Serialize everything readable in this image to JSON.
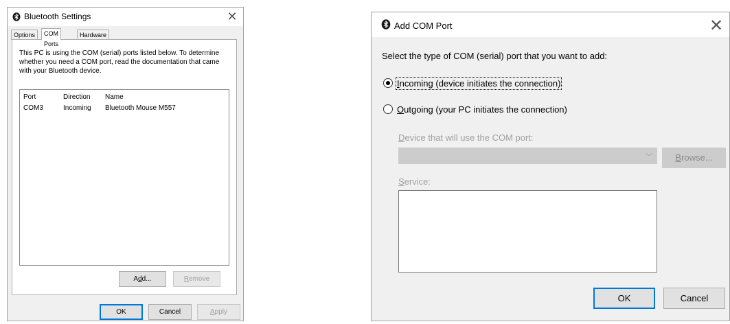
{
  "bluetooth_settings": {
    "title": "Bluetooth Settings",
    "tabs": [
      {
        "label": "Options",
        "active": false
      },
      {
        "label": "COM Ports",
        "active": true
      },
      {
        "label": "Hardware",
        "active": false
      }
    ],
    "intro": "This PC is using the COM (serial) ports listed below. To determine whether you need a COM port, read the documentation that came with your Bluetooth device.",
    "columns": [
      "Port",
      "Direction",
      "Name"
    ],
    "rows": [
      {
        "port": "COM3",
        "direction": "Incoming",
        "name": "Bluetooth Mouse M557"
      }
    ],
    "add_button": {
      "pre": "A",
      "key": "d",
      "post": "d..."
    },
    "remove_button": {
      "pre": "",
      "key": "R",
      "post": "emove"
    },
    "ok_button": "OK",
    "cancel_button": "Cancel",
    "apply_button": {
      "pre": "",
      "key": "A",
      "post": "pply"
    }
  },
  "add_com_port": {
    "title": "Add COM Port",
    "prompt": "Select the type of COM (serial) port that you want to add:",
    "incoming": {
      "key": "I",
      "rest": "ncoming (device initiates the connection)",
      "selected": true
    },
    "outgoing": {
      "key": "O",
      "rest": "utgoing (your PC initiates the connection)",
      "selected": false
    },
    "device_label": {
      "key": "D",
      "rest": "evice that will use the COM port:"
    },
    "device_value": "",
    "browse_button": {
      "key": "B",
      "rest": "rowse..."
    },
    "service_label": {
      "key": "S",
      "rest": "ervice:"
    },
    "service_value": "",
    "ok_button": "OK",
    "cancel_button": "Cancel"
  },
  "icons": {
    "bluetooth": "bluetooth-icon",
    "close": "close-icon",
    "dropdown": "chevron-down-icon"
  }
}
